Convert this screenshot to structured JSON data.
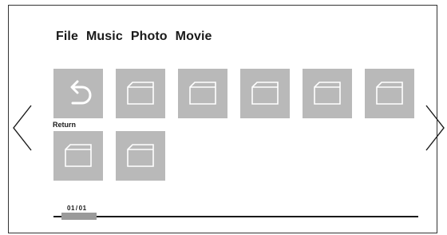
{
  "tabs": [
    {
      "label": "File"
    },
    {
      "label": "Music"
    },
    {
      "label": "Photo"
    },
    {
      "label": "Movie"
    }
  ],
  "items": [
    {
      "type": "return",
      "icon": "return-arrow-icon",
      "label": "Return"
    },
    {
      "type": "folder",
      "icon": "folder-icon"
    },
    {
      "type": "folder",
      "icon": "folder-icon"
    },
    {
      "type": "folder",
      "icon": "folder-icon"
    },
    {
      "type": "folder",
      "icon": "folder-icon"
    },
    {
      "type": "folder",
      "icon": "folder-icon"
    },
    {
      "type": "folder",
      "icon": "folder-icon"
    },
    {
      "type": "folder",
      "icon": "folder-icon"
    }
  ],
  "navigation": {
    "prev_icon": "chevron-left-icon",
    "next_icon": "chevron-right-icon"
  },
  "pagination": {
    "current": "01",
    "total": "01",
    "separator": "/"
  },
  "colors": {
    "tile_background": "#b9b9b9",
    "icon_stroke": "#ffffff",
    "text": "#1a1a1a",
    "progress_thumb": "#9a9a9a"
  }
}
